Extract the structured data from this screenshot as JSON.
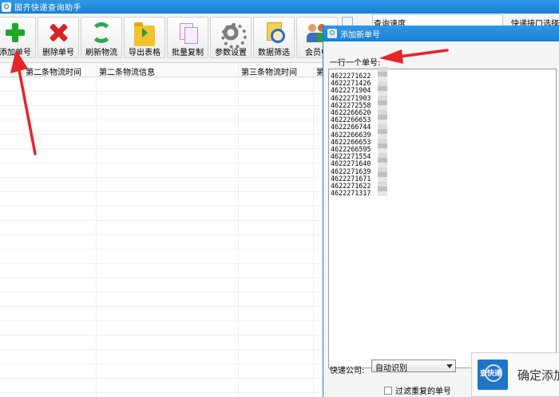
{
  "window": {
    "title": "固齐快递查询助手"
  },
  "toolbar": {
    "buttons": [
      {
        "label": "添加单号",
        "icon": "plus-icon"
      },
      {
        "label": "删除单号",
        "icon": "delete-icon"
      },
      {
        "label": "刷新物流",
        "icon": "refresh-icon"
      },
      {
        "label": "导出表格",
        "icon": "folder-export-icon"
      },
      {
        "label": "批量复制",
        "icon": "copy-icon"
      },
      {
        "label": "参数设置",
        "icon": "gear-icon"
      },
      {
        "label": "数据筛选",
        "icon": "filter-search-icon"
      },
      {
        "label": "会员中",
        "icon": "user-icon"
      }
    ],
    "speed_label": "查询速度",
    "api_label": "快递接口选择"
  },
  "table": {
    "columns": [
      "第二条物流时间",
      "第二条物流信息",
      "第三条物流时间",
      "第"
    ]
  },
  "dialog": {
    "title": "添加新单号",
    "prompt": "一行一个单号:",
    "numbers": [
      "4622271622",
      "4622271426",
      "4622271904",
      "4622271903",
      "4622272558",
      "4622266620",
      "4622266653",
      "4622266744",
      "4622266639",
      "4622266653",
      "4622266595",
      "4622271554",
      "4622271640",
      "4622271639",
      "4622271671",
      "4622271622",
      "4622271317"
    ],
    "company_label": "快递公司:",
    "company_value": "自动识别",
    "filter_label": "过滤重复的单号",
    "logo_text": "查快递",
    "confirm_label": "确定添加"
  },
  "colors": {
    "titlebar": "#1b7fd4",
    "annotation_arrow": "#e8232a"
  }
}
